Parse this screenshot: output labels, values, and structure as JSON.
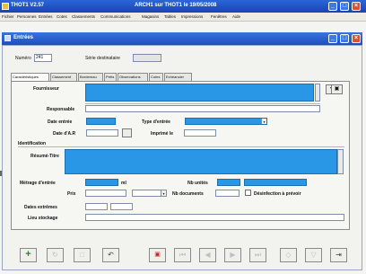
{
  "titlebar": {
    "app_title": "THOT1 V2.57",
    "window_title": "ARCH1 sur THOT1 le 19/05/2008"
  },
  "menubar": {
    "items": [
      "Fichier",
      "Personnes",
      "Entrées",
      "Cotes",
      "Classements",
      "Communications",
      "Magasins",
      "Tables",
      "Impressions",
      "Fenêtres",
      "Aide"
    ]
  },
  "subwindow": {
    "title": "Entrées"
  },
  "form": {
    "numero_label": "Numéro",
    "numero_value": "241",
    "serie_label": "Série destinataire",
    "serie_value": "",
    "tabs": [
      "Caractéristiques",
      "Classement",
      "Bordereau",
      "Prêts",
      "Observations",
      "Cotes",
      "Echéancier"
    ],
    "fournisseur_label": "Fournisseur",
    "responsable_label": "Responsable",
    "date_entree_label": "Date entrée",
    "type_entree_label": "Type d'entrée",
    "date_ar_label": "Date d'A.R",
    "imprime_le_label": "Imprimé le",
    "identification_label": "Identification",
    "resume_titre_label": "Résumé-Titre",
    "metrage_label": "Métrage d'entrée",
    "metrage_unit": "ml",
    "nb_unites_label": "Nb unités",
    "prix_label": "Prix",
    "nb_documents_label": "Nb documents",
    "desinfection_label": "Désinfection à prévoir",
    "dates_extremes_label": "Dates extrêmes",
    "lieu_stockage_label": "Lieu stockage"
  },
  "colors": {
    "title_blue": "#1d4fbd",
    "field_highlight": "#2a97e6"
  },
  "icons": {
    "add": "plus-icon",
    "undo": "undo-icon",
    "print": "printer-icon",
    "exit": "exit-icon"
  }
}
